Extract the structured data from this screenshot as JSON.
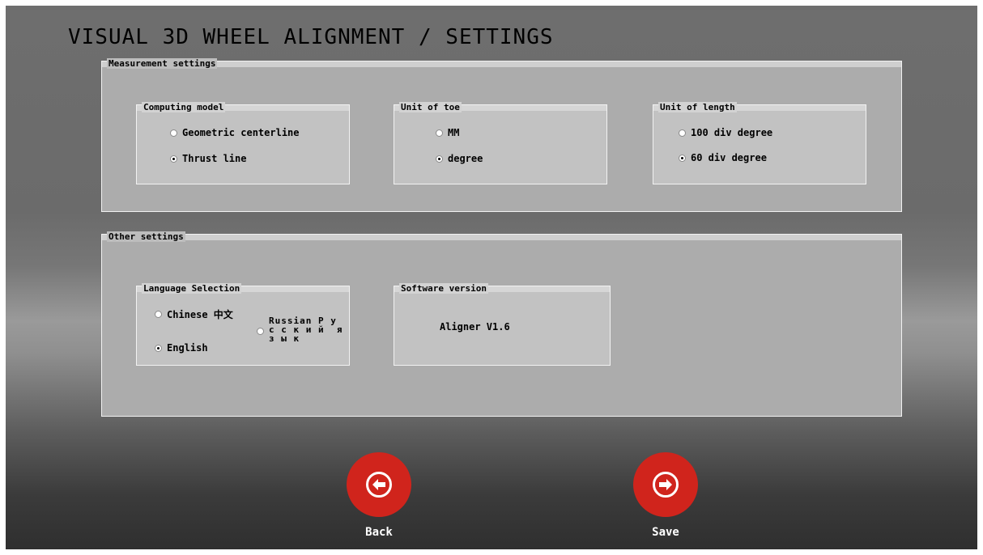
{
  "header": {
    "title": "VISUAL 3D WHEEL ALIGNMENT / SETTINGS"
  },
  "measurement": {
    "legend": "Measurement settings",
    "computing_model": {
      "legend": "Computing model",
      "options": [
        {
          "label": "Geometric centerline",
          "selected": false
        },
        {
          "label": "Thrust line",
          "selected": true
        }
      ]
    },
    "unit_of_toe": {
      "legend": "Unit of toe",
      "options": [
        {
          "label": "MM",
          "selected": false
        },
        {
          "label": "degree",
          "selected": true
        }
      ]
    },
    "unit_of_length": {
      "legend": "Unit of length",
      "options": [
        {
          "label": "100 div degree",
          "selected": false
        },
        {
          "label": "60 div degree",
          "selected": true
        }
      ]
    }
  },
  "other": {
    "legend": "Other settings",
    "language": {
      "legend": "Language Selection",
      "chinese": "Chinese 中文",
      "english": "English",
      "russian": "Russian Р у\nс с к и й  я\nз ы к",
      "selected": "English"
    },
    "software": {
      "legend": "Software version",
      "value": "Aligner V1.6"
    }
  },
  "footer": {
    "back_label": "Back",
    "save_label": "Save"
  },
  "colors": {
    "accent": "#d0241c"
  },
  "icons": {
    "back": "arrow-left-circle-icon",
    "save": "arrow-right-circle-icon"
  }
}
